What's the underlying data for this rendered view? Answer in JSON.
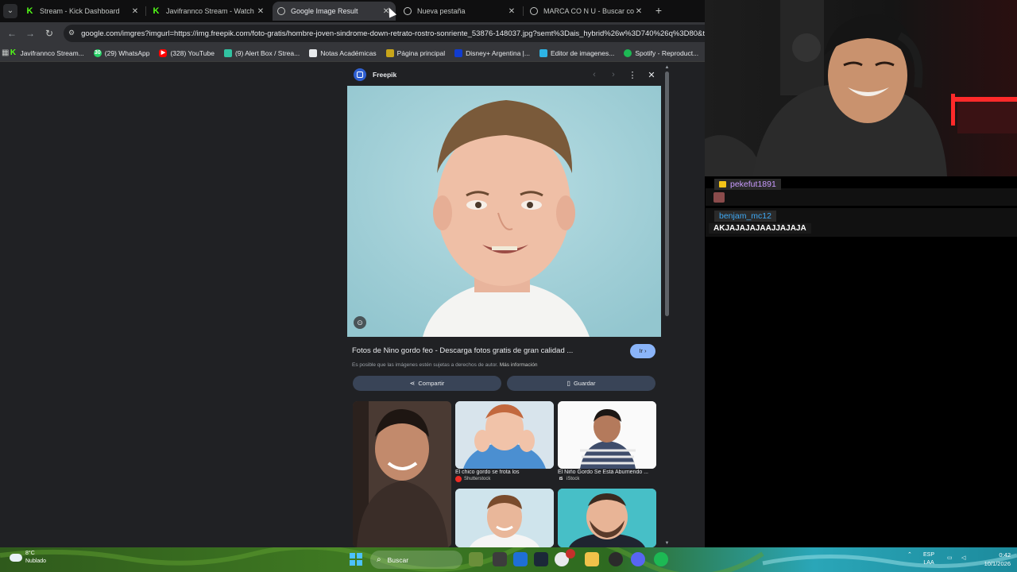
{
  "tabs": [
    {
      "title": "Stream - Kick Dashboard",
      "favicon": "kick-icon"
    },
    {
      "title": "Javifrannco Stream - Watch Live",
      "favicon": "kick-icon"
    },
    {
      "title": "Google Image Result",
      "favicon": "google-icon",
      "active": true
    },
    {
      "title": "Nueva pestaña",
      "favicon": "google-icon"
    },
    {
      "title": "MARCA CO N U - Buscar con Google",
      "favicon": "google-icon"
    }
  ],
  "address_bar": {
    "url": "google.com/imgres?imgurl=https://img.freepik.com/foto-gratis/hombre-joven-sindrome-down-retrato-rostro-sonriente_53876-148037.jpg?semt%3Dais_hybrid%26w%3D740%26q%3D80&tbn"
  },
  "bookmarks": [
    {
      "label": "Javifrannco Stream...",
      "icon": "kick-icon",
      "color": "#53fc18"
    },
    {
      "label": "(29) WhatsApp",
      "icon": "whatsapp-icon",
      "color": "#25d366",
      "badge": "30"
    },
    {
      "label": "(328) YouTube",
      "icon": "youtube-icon",
      "color": "#ff0000"
    },
    {
      "label": "(9) Alert Box / Strea...",
      "icon": "streamlabs-icon",
      "color": "#31c3a2"
    },
    {
      "label": "Notas Académicas",
      "icon": "page-icon",
      "color": "#e8eaed"
    },
    {
      "label": "Página principal",
      "icon": "home-page-icon",
      "color": "#c8a51a"
    },
    {
      "label": "Disney+ Argentina |...",
      "icon": "disney-icon",
      "color": "#113ccf"
    },
    {
      "label": "Editor de imagenes...",
      "icon": "editor-icon",
      "color": "#2db4e5"
    },
    {
      "label": "Spotify - Reproduct...",
      "icon": "spotify-icon",
      "color": "#1db954"
    }
  ],
  "result_panel": {
    "source": "Freepik",
    "title": "Fotos de Nino gordo feo - Descarga fotos gratis de gran calidad ...",
    "go_label": "Ir",
    "rights_text": "Es posible que las imágenes estén sujetas a derechos de autor.",
    "rights_link": "Más información",
    "share_label": "Compartir",
    "save_label": "Guardar",
    "related": [
      {
        "caption": "El chico gordo se frota los",
        "source": "Shutterstock"
      },
      {
        "caption": "El Niño Gordo Se Está Aburriendo ...",
        "source": "iStock"
      }
    ]
  },
  "chat": {
    "messages": [
      {
        "user": "pekefut1891",
        "user_color": "#c99bff",
        "text": ""
      },
      {
        "user": "benjam_mc12",
        "user_color": "#3fa9f5",
        "text": "AKJAJAJAJAAJJAJAJA"
      }
    ]
  },
  "taskbar": {
    "weather_temp": "8°C",
    "weather_desc": "Nublado",
    "search_placeholder": "Buscar",
    "lang": "ESP",
    "lang_sub": "LAA",
    "time": "0:42",
    "date": "10/1/2026"
  }
}
